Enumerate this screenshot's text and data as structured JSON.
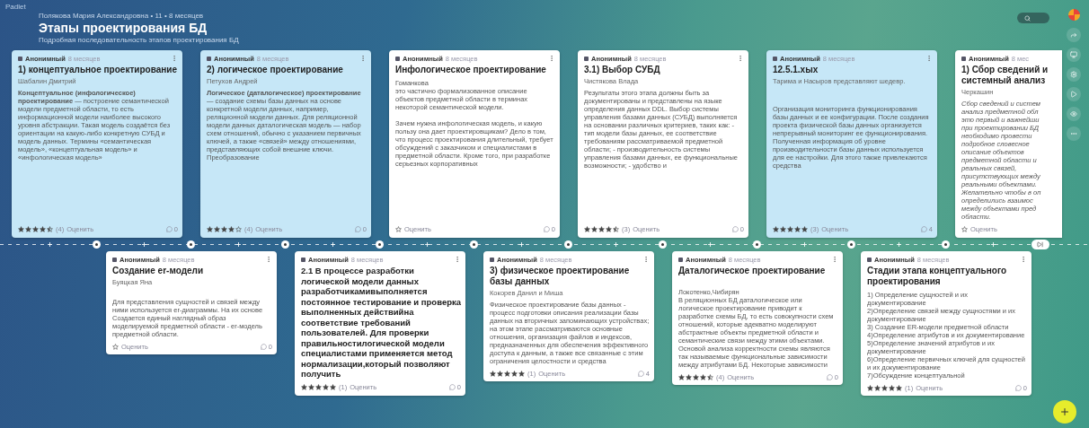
{
  "brand": "Padlet",
  "board": {
    "meta": "Полякова Мария Александровна • 11 • 8 месяцев",
    "title": "Этапы проектирования БД",
    "subtitle": "Подробная последовательность этапов проектирования БД"
  },
  "top_cards": [
    {
      "color": "#c6e7f7",
      "author": "Анонимный",
      "time": "8 месяцев",
      "title": "1) концептуальное проектирование",
      "byline": "Шабалин Дмитрий",
      "body": "**Концептуальное (инфологическое) проектирование** — построение семантической модели предметной области, то есть информационной модели наиболее высокого уровня абстракции. Такая модель создаётся без ориентации на какую-либо конкретную СУБД и модель данных. Термины «семантическая модель», «концептуальная модель» и «инфологическая модель»",
      "rating": {
        "stars": 4.5,
        "count": "(4)"
      },
      "rate_label": "Оценить",
      "comments": "0"
    },
    {
      "color": "#c6e7f7",
      "author": "Анонимный",
      "time": "8 месяцев",
      "title": "2) логическое проектирование",
      "byline": "Петухов Андрей",
      "body": "**Логическое (даталогическое) проектирование** — создание схемы базы данных на основе конкретной модели данных, например, реляционной модели данных. Для реляционной модели данных даталогическая модель — набор схем отношений, обычно с указанием первичных ключей, а также «связей» между отношениями, представляющих собой внешние ключи. Преобразование",
      "rating": {
        "stars": 4,
        "count": "(4)"
      },
      "rate_label": "Оценить",
      "comments": "0"
    },
    {
      "color": "#ffffff",
      "author": "Анонимный",
      "time": "8 месяцев",
      "title": "Инфологическое проектирование",
      "body": "Гоманкова\nэто частично формализованное описание объектов предметной области в терминах некоторой семантической модели.\n\nЗачем нужна инфологическая модель, и какую пользу она дает проектировщикам? Дело в том, что процесс проектирования длительный, требует обсуждений с заказчиком и специалистами в предметной области. Кроме того, при разработке серьезных корпоративных",
      "rate_label": "Оценить",
      "comments": "0"
    },
    {
      "color": "#ffffff",
      "author": "Анонимный",
      "time": "8 месяцев",
      "title": "3.1) Выбор СУБД",
      "byline": "Чистякова Влада",
      "body": "Результаты этого этапа должны быть за документированы и представлены на языке определения данных DDL. Выбор системы управления базами данных (СУБД) выполняется на основании различных критериев, таких как: - тип модели базы данных, ее соответствие требованиям рассматриваемой предметной области; - производительность системы управления базами данных, ее функциональные возможности; - удобство и",
      "rating": {
        "stars": 4.5,
        "count": "(3)"
      },
      "rate_label": "Оценить",
      "comments": "0"
    },
    {
      "color": "#c6e7f7",
      "author": "Анонимный",
      "time": "8 месяцев",
      "title": "12.5.1.xых",
      "byline": "Тарима и Насыров представляют шедевр.",
      "body": "\n\nОрганизация мониторинга функционирования базы данных и ее конфигурации. После создания проекта физической базы данных организуется непрерывный мониторинг ее функционирования. Полученная информация об уровне производительности базы данных используется для ее настройки. Для этого также привлекаются средства",
      "rating": {
        "stars": 5,
        "count": "(3)"
      },
      "rate_label": "Оценить",
      "comments": "4"
    },
    {
      "color": "#ffffff",
      "author": "Анонимный",
      "time": "8 мес",
      "title": "1) Сбор сведений и\nсистемный анализ",
      "byline": "Черкашин",
      "body": "Сбор сведений и систем\nанализ предметной обл\nэто первый и важнейши\nпри проектировании БД\nнеобходимо провести\nподробное словесное\nописание объектов\nпредметной области и\nреальных связей,\nприсутствующих между\nреальными объектами.\nЖелательно чтобы в оп\nопределились взаимос\nмежду объектами пред\nобласти.",
      "italic": true,
      "rate_label": "Оценить"
    }
  ],
  "bottom_cards": [
    {
      "color": "#ffffff",
      "author": "Анонимный",
      "time": "8 месяцев",
      "title": "Создание er-модели",
      "byline": "Буяцкая Яна",
      "body": "\nДля представления сущностей и связей между ними используется er-диаграммы. На их основе Создается единый наглядный образ моделируемой предметной области - er-модель предметной области.",
      "rate_label": "Оценить",
      "comments": "0"
    },
    {
      "color": "#ffffff",
      "author": "Анонимный",
      "time": "8 месяцев",
      "title": "2.1 В процессе разработки логической модели данных разработчикамивыполняется постоянное тестирование и проверка выполненных действийна соответствие требований пользователей. Для проверки правильностилогической модели специалистами применяется метод нормализации,который позволяют получить",
      "rating": {
        "stars": 5,
        "count": "(1)"
      },
      "rate_label": "Оценить",
      "comments": "0"
    },
    {
      "color": "#ffffff",
      "author": "Анонимный",
      "time": "8 месяцев",
      "title": "3) физическое проектирование базы данных",
      "byline": "Кокорев Данил и Миша",
      "body": "Физическое проектирование базы данных - процесс подготовки описания реализации базы данных на вторичных запоминающих устройствах; на этом этапе рассматриваются основные отношения, организация файлов и индексов, предназначенных для обеспечения эффективного доступа к данным, а также все связанные с этим ограничения целостности и средства",
      "rating": {
        "stars": 5,
        "count": "(1)"
      },
      "rate_label": "Оценить",
      "comments": "4"
    },
    {
      "color": "#ffffff",
      "author": "Анонимный",
      "time": "8 месяцев",
      "title": "Даталогическое проектирование",
      "body": "\nЛокотенко,Чибирян\nВ реляционных БД даталогическое или логическое проектирование приводит к разработке схемы БД, то есть совокупности схем отношений, которые адекватно моделируют абстрактные объекты предметной области и семантические связи между этими объектами. Основой анализа корректности схемы являются так называемые функциональные зависимости между атрибутами БД. Некоторые зависимости",
      "rating": {
        "stars": 4.5,
        "count": "(4)"
      },
      "rate_label": "Оценить",
      "comments": "0"
    },
    {
      "color": "#ffffff",
      "author": "Анонимный",
      "time": "8 месяцев",
      "title": "Стадии этапа концептуального проектирования",
      "body": "1) Определение сущностей и их документирование\n2)Определение связей между сущностями  и их документирование\n3) Создание ER-модели предметной области\n4)Определение атрибутов и их документирование\n5)Определение значений атрибутов и их документирование\n6)Определение первичных ключей для сущностей и их документирование\n7)Обсуждение концептуальной",
      "rating": {
        "stars": 5,
        "count": "(1)"
      },
      "rate_label": "Оценить",
      "comments": "0"
    }
  ]
}
